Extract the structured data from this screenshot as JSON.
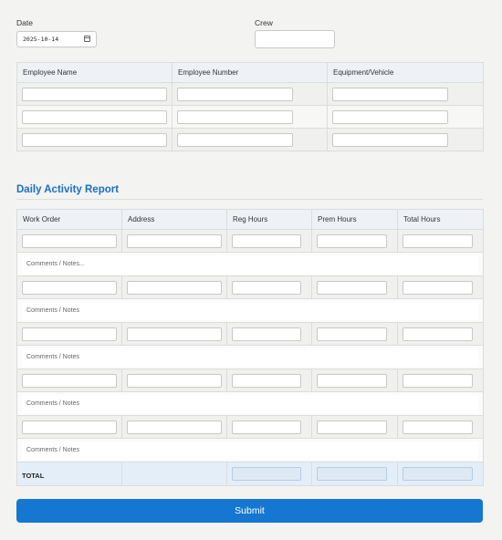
{
  "header": {
    "date_label": "Date",
    "date_value": "2025-10-14",
    "crew_label": "Crew"
  },
  "crew_table": {
    "columns": [
      "Employee Name",
      "Employee Number",
      "Equipment/Vehicle"
    ]
  },
  "activity": {
    "title": "Daily Activity Report",
    "columns": [
      "Work Order",
      "Address",
      "Reg Hours",
      "Prem Hours",
      "Total Hours"
    ],
    "notes_placeholders": [
      "Comments / Notes...",
      "Comments / Notes",
      "Comments / Notes",
      "Comments / Notes",
      "Comments / Notes"
    ],
    "total_label": "TOTAL"
  },
  "submit_label": "Submit"
}
